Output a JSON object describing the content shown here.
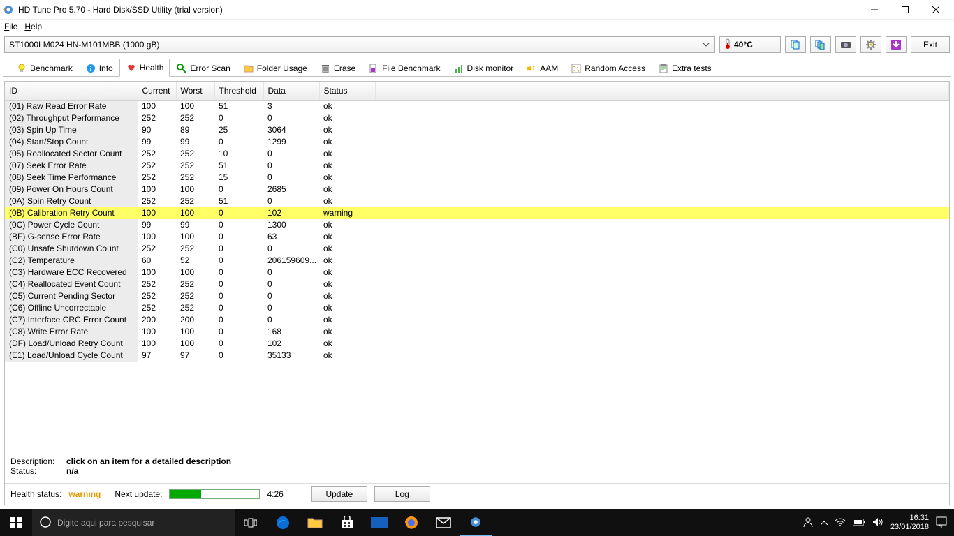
{
  "window": {
    "title": "HD Tune Pro 5.70 - Hard Disk/SSD Utility (trial version)"
  },
  "menu": {
    "file": "File",
    "help": "Help"
  },
  "device": {
    "selected": "ST1000LM024 HN-M101MBB (1000 gB)",
    "temperature": "40°C",
    "exit": "Exit"
  },
  "tabs": [
    {
      "label": "Benchmark",
      "icon": "bulb-icon"
    },
    {
      "label": "Info",
      "icon": "info-icon"
    },
    {
      "label": "Health",
      "icon": "heart-icon",
      "active": true
    },
    {
      "label": "Error Scan",
      "icon": "search-icon"
    },
    {
      "label": "Folder Usage",
      "icon": "folder-icon"
    },
    {
      "label": "Erase",
      "icon": "trash-icon"
    },
    {
      "label": "File Benchmark",
      "icon": "file-icon"
    },
    {
      "label": "Disk monitor",
      "icon": "chart-icon"
    },
    {
      "label": "AAM",
      "icon": "speaker-icon"
    },
    {
      "label": "Random Access",
      "icon": "random-icon"
    },
    {
      "label": "Extra tests",
      "icon": "clipboard-icon"
    }
  ],
  "columns": {
    "id": "ID",
    "current": "Current",
    "worst": "Worst",
    "threshold": "Threshold",
    "data": "Data",
    "status": "Status"
  },
  "rows": [
    {
      "id": "(01) Raw Read Error Rate",
      "cur": "100",
      "wor": "100",
      "thr": "51",
      "dat": "3",
      "sta": "ok"
    },
    {
      "id": "(02) Throughput Performance",
      "cur": "252",
      "wor": "252",
      "thr": "0",
      "dat": "0",
      "sta": "ok"
    },
    {
      "id": "(03) Spin Up Time",
      "cur": "90",
      "wor": "89",
      "thr": "25",
      "dat": "3064",
      "sta": "ok"
    },
    {
      "id": "(04) Start/Stop Count",
      "cur": "99",
      "wor": "99",
      "thr": "0",
      "dat": "1299",
      "sta": "ok"
    },
    {
      "id": "(05) Reallocated Sector Count",
      "cur": "252",
      "wor": "252",
      "thr": "10",
      "dat": "0",
      "sta": "ok"
    },
    {
      "id": "(07) Seek Error Rate",
      "cur": "252",
      "wor": "252",
      "thr": "51",
      "dat": "0",
      "sta": "ok"
    },
    {
      "id": "(08) Seek Time Performance",
      "cur": "252",
      "wor": "252",
      "thr": "15",
      "dat": "0",
      "sta": "ok"
    },
    {
      "id": "(09) Power On Hours Count",
      "cur": "100",
      "wor": "100",
      "thr": "0",
      "dat": "2685",
      "sta": "ok"
    },
    {
      "id": "(0A) Spin Retry Count",
      "cur": "252",
      "wor": "252",
      "thr": "51",
      "dat": "0",
      "sta": "ok"
    },
    {
      "id": "(0B) Calibration Retry Count",
      "cur": "100",
      "wor": "100",
      "thr": "0",
      "dat": "102",
      "sta": "warning",
      "warn": true
    },
    {
      "id": "(0C) Power Cycle Count",
      "cur": "99",
      "wor": "99",
      "thr": "0",
      "dat": "1300",
      "sta": "ok"
    },
    {
      "id": "(BF) G-sense Error Rate",
      "cur": "100",
      "wor": "100",
      "thr": "0",
      "dat": "63",
      "sta": "ok"
    },
    {
      "id": "(C0) Unsafe Shutdown Count",
      "cur": "252",
      "wor": "252",
      "thr": "0",
      "dat": "0",
      "sta": "ok"
    },
    {
      "id": "(C2) Temperature",
      "cur": "60",
      "wor": "52",
      "thr": "0",
      "dat": "206159609...",
      "sta": "ok"
    },
    {
      "id": "(C3) Hardware ECC Recovered",
      "cur": "100",
      "wor": "100",
      "thr": "0",
      "dat": "0",
      "sta": "ok"
    },
    {
      "id": "(C4) Reallocated Event Count",
      "cur": "252",
      "wor": "252",
      "thr": "0",
      "dat": "0",
      "sta": "ok"
    },
    {
      "id": "(C5) Current Pending Sector",
      "cur": "252",
      "wor": "252",
      "thr": "0",
      "dat": "0",
      "sta": "ok"
    },
    {
      "id": "(C6) Offline Uncorrectable",
      "cur": "252",
      "wor": "252",
      "thr": "0",
      "dat": "0",
      "sta": "ok"
    },
    {
      "id": "(C7) Interface CRC Error Count",
      "cur": "200",
      "wor": "200",
      "thr": "0",
      "dat": "0",
      "sta": "ok"
    },
    {
      "id": "(C8) Write Error Rate",
      "cur": "100",
      "wor": "100",
      "thr": "0",
      "dat": "168",
      "sta": "ok"
    },
    {
      "id": "(DF) Load/Unload Retry Count",
      "cur": "100",
      "wor": "100",
      "thr": "0",
      "dat": "102",
      "sta": "ok"
    },
    {
      "id": "(E1) Load/Unload Cycle Count",
      "cur": "97",
      "wor": "97",
      "thr": "0",
      "dat": "35133",
      "sta": "ok"
    }
  ],
  "details": {
    "desc_label": "Description:",
    "desc_value": "click on an item for a detailed description",
    "status_label": "Status:",
    "status_value": "n/a"
  },
  "footer": {
    "health_label": "Health status:",
    "health_value": "warning",
    "next_update_label": "Next update:",
    "countdown": "4:26",
    "update_btn": "Update",
    "log_btn": "Log"
  },
  "taskbar": {
    "search_placeholder": "Digite aqui para pesquisar",
    "time": "16:31",
    "date": "23/01/2018"
  }
}
